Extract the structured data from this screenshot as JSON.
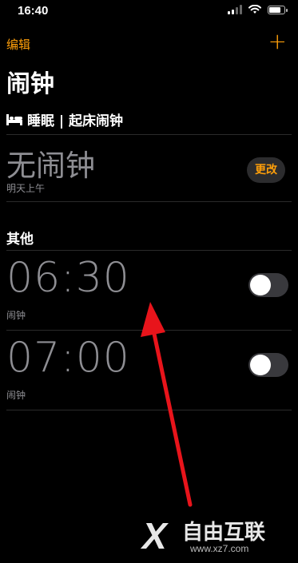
{
  "status_bar": {
    "time": "16:40",
    "battery_level": 0.8
  },
  "nav": {
    "edit_label": "编辑",
    "add_label": "+"
  },
  "page_title": "闹钟",
  "sleep": {
    "header": "睡眠 | 起床闹钟",
    "no_alarm": "无闹钟",
    "tomorrow": "明天上午",
    "change_label": "更改"
  },
  "other": {
    "section_title": "其他",
    "alarms": [
      {
        "time": "06:30",
        "label": "闹钟",
        "enabled": false
      },
      {
        "time": "07:00",
        "label": "闹钟",
        "enabled": false
      }
    ]
  },
  "annotation": {
    "arrow_color": "#e8141b"
  },
  "watermark": {
    "brand_text": "自由互联",
    "url": "www.xz7.com"
  },
  "colors": {
    "accent": "#ff9f0a",
    "secondary_text": "#8e8e93",
    "background": "#000000"
  }
}
